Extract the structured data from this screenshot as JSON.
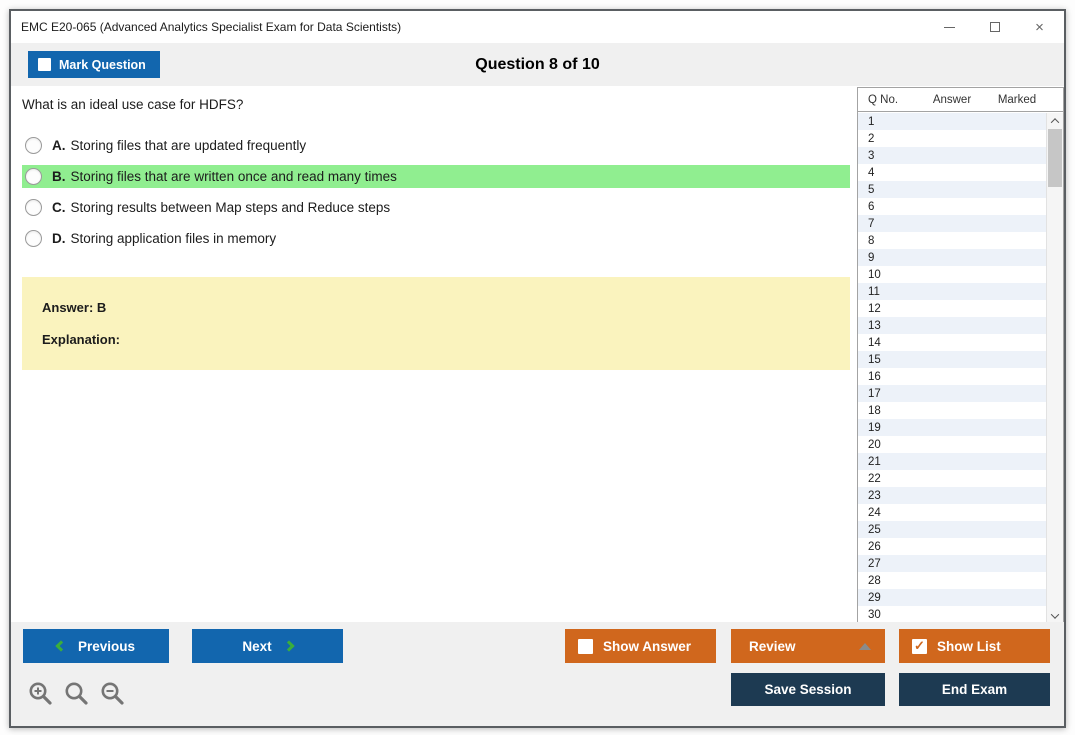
{
  "window": {
    "title": "EMC E20-065 (Advanced Analytics Specialist Exam for Data Scientists)",
    "controls": {
      "close_glyph": "×"
    }
  },
  "toolbar": {
    "mark_question_label": "Mark Question",
    "mark_question_checked": false,
    "question_counter": "Question 8 of 10"
  },
  "question": {
    "text": "What is an ideal use case for HDFS?",
    "options": [
      {
        "letter": "A.",
        "text": "Storing files that are updated frequently",
        "highlighted": false
      },
      {
        "letter": "B.",
        "text": "Storing files that are written once and read many times",
        "highlighted": true
      },
      {
        "letter": "C.",
        "text": "Storing results between Map steps and Reduce steps",
        "highlighted": false
      },
      {
        "letter": "D.",
        "text": "Storing application files in memory",
        "highlighted": false
      }
    ],
    "answer_label": "Answer: B",
    "explanation_label": "Explanation:"
  },
  "question_list": {
    "headers": [
      "Q No.",
      "Answer",
      "Marked"
    ],
    "rows": [
      {
        "q_no": "1",
        "answer": "",
        "marked": ""
      },
      {
        "q_no": "2",
        "answer": "",
        "marked": ""
      },
      {
        "q_no": "3",
        "answer": "",
        "marked": ""
      },
      {
        "q_no": "4",
        "answer": "",
        "marked": ""
      },
      {
        "q_no": "5",
        "answer": "",
        "marked": ""
      },
      {
        "q_no": "6",
        "answer": "",
        "marked": ""
      },
      {
        "q_no": "7",
        "answer": "",
        "marked": ""
      },
      {
        "q_no": "8",
        "answer": "",
        "marked": ""
      },
      {
        "q_no": "9",
        "answer": "",
        "marked": ""
      },
      {
        "q_no": "10",
        "answer": "",
        "marked": ""
      },
      {
        "q_no": "11",
        "answer": "",
        "marked": ""
      },
      {
        "q_no": "12",
        "answer": "",
        "marked": ""
      },
      {
        "q_no": "13",
        "answer": "",
        "marked": ""
      },
      {
        "q_no": "14",
        "answer": "",
        "marked": ""
      },
      {
        "q_no": "15",
        "answer": "",
        "marked": ""
      },
      {
        "q_no": "16",
        "answer": "",
        "marked": ""
      },
      {
        "q_no": "17",
        "answer": "",
        "marked": ""
      },
      {
        "q_no": "18",
        "answer": "",
        "marked": ""
      },
      {
        "q_no": "19",
        "answer": "",
        "marked": ""
      },
      {
        "q_no": "20",
        "answer": "",
        "marked": ""
      },
      {
        "q_no": "21",
        "answer": "",
        "marked": ""
      },
      {
        "q_no": "22",
        "answer": "",
        "marked": ""
      },
      {
        "q_no": "23",
        "answer": "",
        "marked": ""
      },
      {
        "q_no": "24",
        "answer": "",
        "marked": ""
      },
      {
        "q_no": "25",
        "answer": "",
        "marked": ""
      },
      {
        "q_no": "26",
        "answer": "",
        "marked": ""
      },
      {
        "q_no": "27",
        "answer": "",
        "marked": ""
      },
      {
        "q_no": "28",
        "answer": "",
        "marked": ""
      },
      {
        "q_no": "29",
        "answer": "",
        "marked": ""
      },
      {
        "q_no": "30",
        "answer": "",
        "marked": ""
      }
    ]
  },
  "footer": {
    "previous_label": "Previous",
    "next_label": "Next",
    "show_answer_label": "Show Answer",
    "show_answer_checked": false,
    "review_label": "Review",
    "show_list_label": "Show List",
    "show_list_checked": true,
    "save_session_label": "Save Session",
    "end_exam_label": "End Exam"
  },
  "icons": {
    "checkmark_glyph": "✓",
    "zoom_in_symbol": "+",
    "zoom_out_symbol": "−",
    "names": [
      "minimize-icon",
      "maximize-icon",
      "close-icon",
      "chevron-left-icon",
      "chevron-right-icon",
      "up-triangle-icon",
      "zoom-in-icon",
      "zoom-lens-icon",
      "zoom-out-icon",
      "scroll-up-icon",
      "scroll-down-icon"
    ]
  },
  "colors": {
    "primary_blue": "#1266AE",
    "orange": "#D0671D",
    "navy": "#1D3A52",
    "green_highlight": "#90EE90",
    "answer_yellow": "#FAF3BE",
    "row_alt_blue": "#EDF2F9",
    "chevron_green": "#3BAE3B",
    "toolbar_gray": "#F0F0F0",
    "border_gray": "#5A5E62"
  }
}
